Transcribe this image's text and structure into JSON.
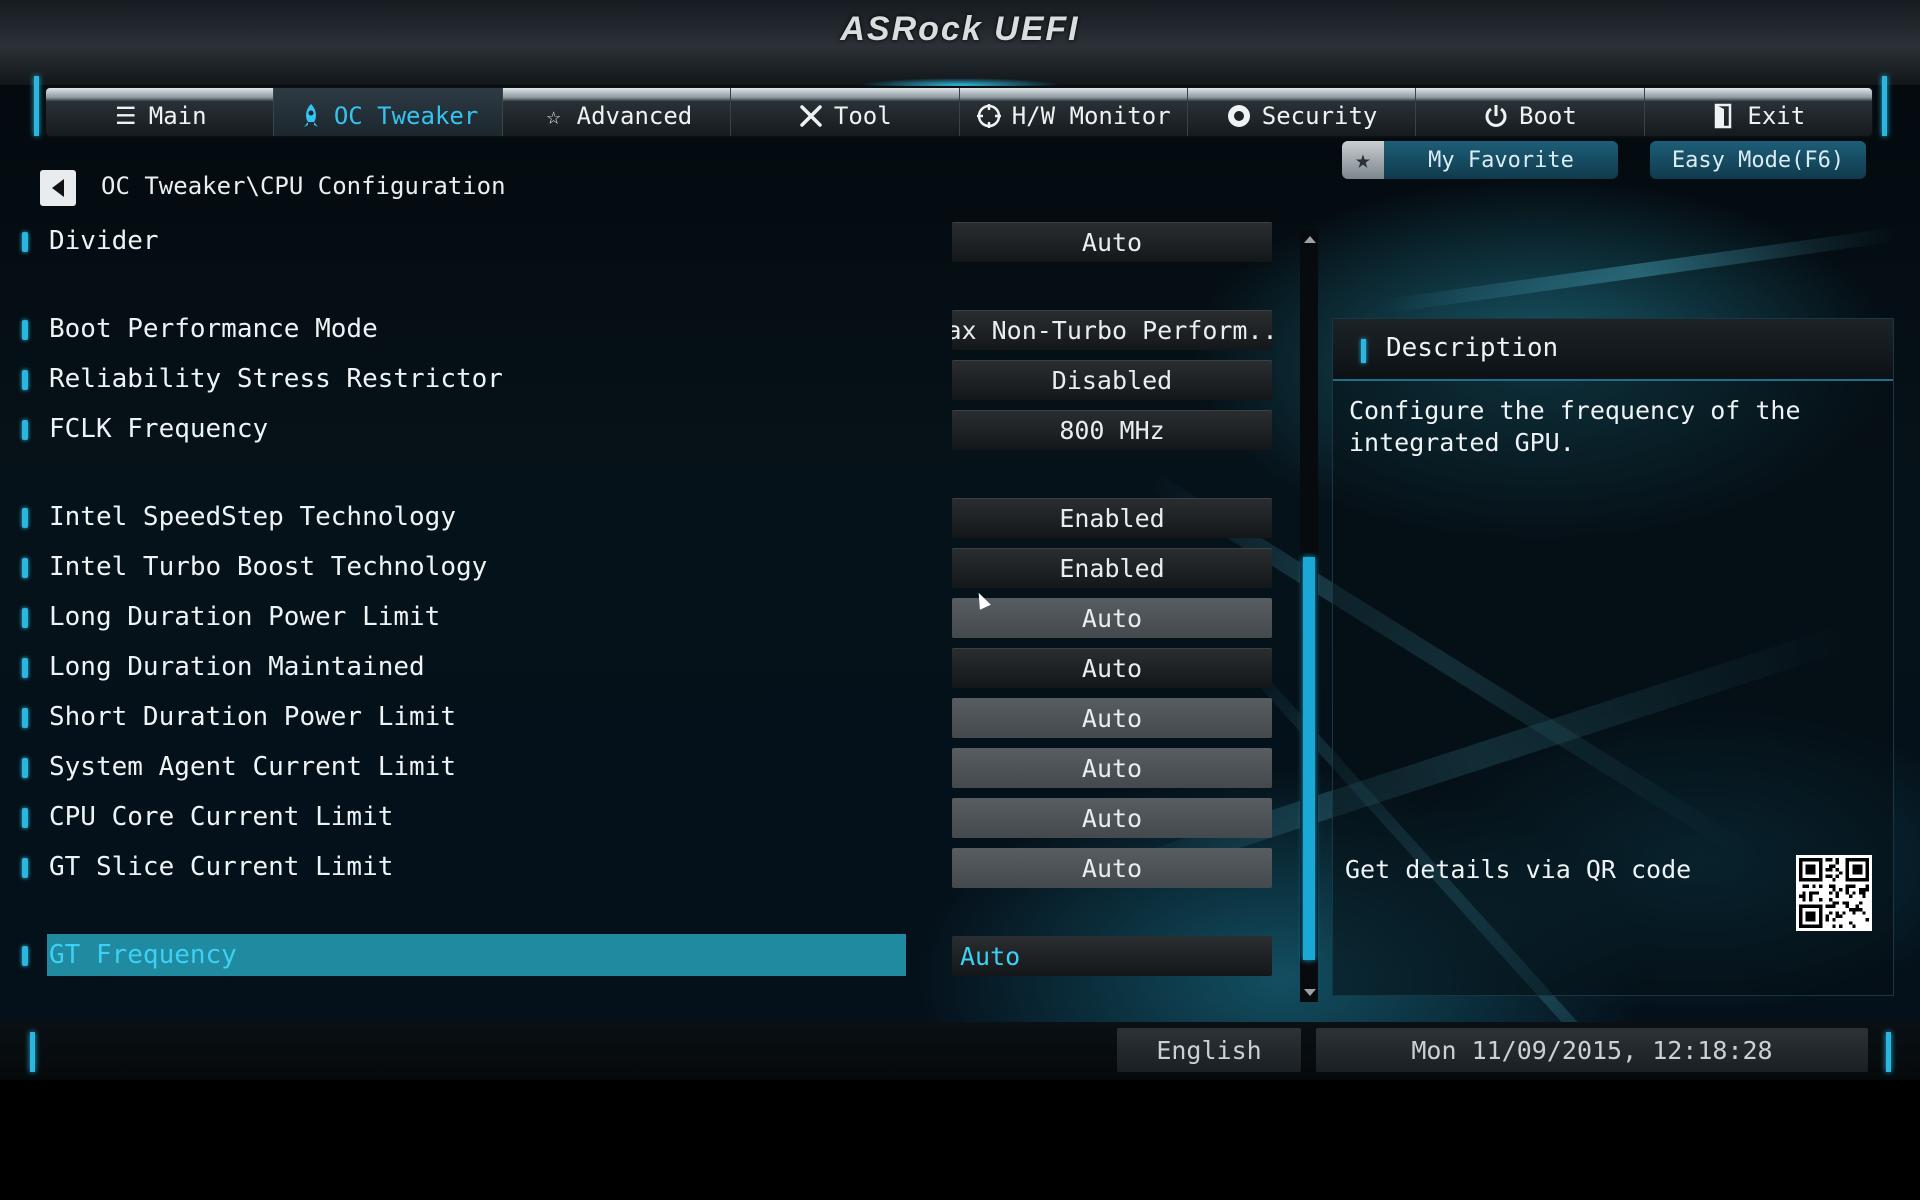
{
  "header": {
    "logo": "ASRock UEFI"
  },
  "tabs": [
    {
      "label": "Main",
      "icon": "list-icon",
      "active": false
    },
    {
      "label": "OC Tweaker",
      "icon": "rocket-icon",
      "active": true
    },
    {
      "label": "Advanced",
      "icon": "star-outline-icon",
      "active": false
    },
    {
      "label": "Tool",
      "icon": "tools-icon",
      "active": false
    },
    {
      "label": "H/W Monitor",
      "icon": "crosshair-icon",
      "active": false
    },
    {
      "label": "Security",
      "icon": "shield-icon",
      "active": false
    },
    {
      "label": "Boot",
      "icon": "power-icon",
      "active": false
    },
    {
      "label": "Exit",
      "icon": "exit-door-icon",
      "active": false
    }
  ],
  "breadcrumb": "OC Tweaker\\CPU Configuration",
  "favorite": {
    "label": "My Favorite",
    "icon": "star-icon"
  },
  "easy_mode": {
    "label": "Easy Mode(F6)"
  },
  "settings": [
    {
      "label": "Divider",
      "value": "Auto",
      "style": "dark"
    },
    {
      "label": "Boot Performance Mode",
      "value": "Max Non-Turbo Perform...",
      "style": "dark"
    },
    {
      "label": "Reliability Stress Restrictor",
      "value": "Disabled",
      "style": "dark"
    },
    {
      "label": "FCLK Frequency",
      "value": "800 MHz",
      "style": "dark"
    },
    {
      "label": "Intel SpeedStep Technology",
      "value": "Enabled",
      "style": "dark"
    },
    {
      "label": "Intel Turbo Boost Technology",
      "value": "Enabled",
      "style": "dark"
    },
    {
      "label": "Long Duration Power Limit",
      "value": "Auto",
      "style": "grey"
    },
    {
      "label": "Long Duration Maintained",
      "value": "Auto",
      "style": "dark"
    },
    {
      "label": "Short Duration Power Limit",
      "value": "Auto",
      "style": "grey"
    },
    {
      "label": "System Agent Current Limit",
      "value": "Auto",
      "style": "grey"
    },
    {
      "label": "CPU Core Current Limit",
      "value": "Auto",
      "style": "grey"
    },
    {
      "label": "GT Slice Current Limit",
      "value": "Auto",
      "style": "grey"
    },
    {
      "label": "GT Frequency",
      "value": "Auto",
      "style": "selected"
    }
  ],
  "scroll": {
    "thumb_start": 0.42,
    "thumb_end": 0.97
  },
  "description": {
    "title": "Description",
    "text": "Configure the frequency of the integrated GPU.",
    "qr_label": "Get details via QR code"
  },
  "footer": {
    "language": "English",
    "datetime": "Mon 11/09/2015, 12:18:28"
  },
  "colors": {
    "accent": "#2bb6e0",
    "selected_bg": "#1f8aa0",
    "selected_text": "#3ecff5"
  }
}
